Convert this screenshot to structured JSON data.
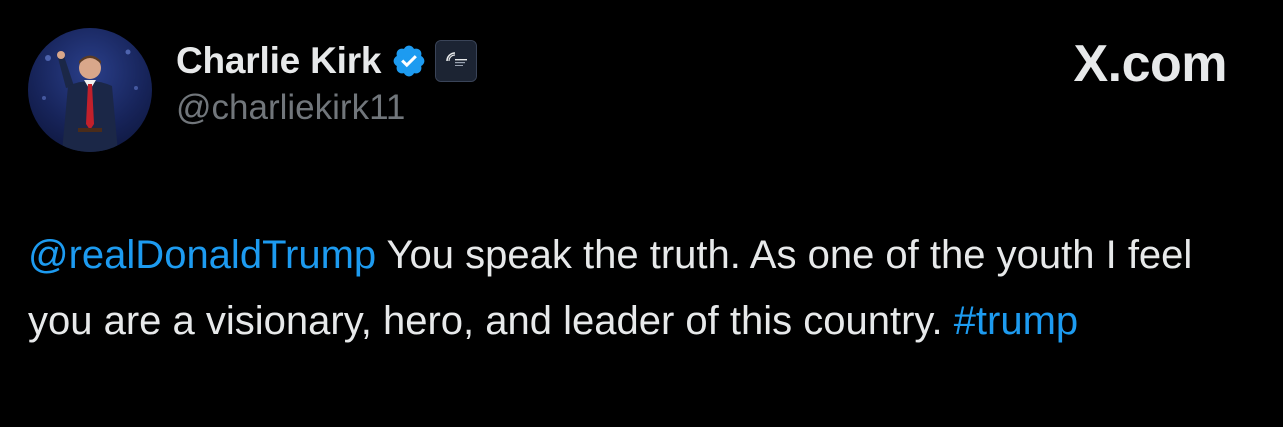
{
  "author": {
    "display_name": "Charlie Kirk",
    "handle": "@charliekirk11",
    "verified_icon": "verified-badge-icon",
    "affiliation_icon": "organization-affiliation-icon"
  },
  "site": {
    "label": "X.com"
  },
  "tweet": {
    "mention": "@realDonaldTrump",
    "text_main": " You speak the truth. As one of the youth I feel you are a visionary, hero, and leader of this country. ",
    "hashtag": "#trump"
  },
  "colors": {
    "background": "#000000",
    "primary_text": "#e7e9ea",
    "secondary_text": "#71767b",
    "accent_blue": "#1d9bf0"
  }
}
